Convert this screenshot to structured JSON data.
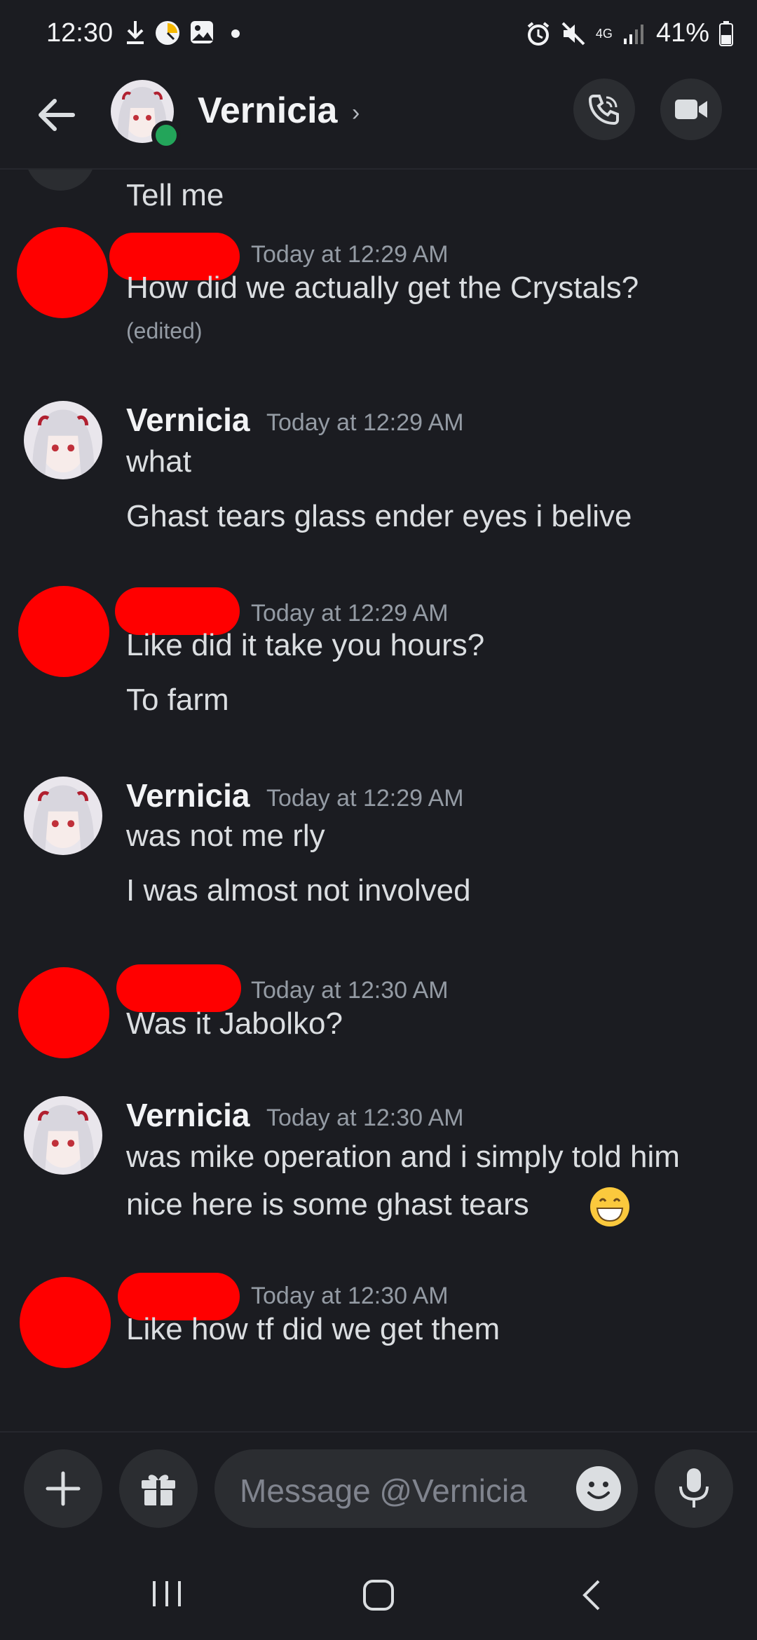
{
  "status_bar": {
    "time": "12:30",
    "battery": "41%",
    "network": "4G"
  },
  "header": {
    "contact_name": "Vernicia",
    "chevron": "›",
    "icons": [
      "back-arrow-icon",
      "voice-call-icon",
      "video-call-icon"
    ]
  },
  "partial_message": {
    "text": "Tell me"
  },
  "messages": [
    {
      "author": "",
      "redacted": true,
      "timestamp": "Today at 12:29 AM",
      "lines": [
        "How did we actually get the Crystals?"
      ],
      "edited": "(edited)"
    },
    {
      "author": "Vernicia",
      "redacted": false,
      "timestamp": "Today at 12:29 AM",
      "lines": [
        "what",
        "Ghast tears glass ender eyes i belive"
      ]
    },
    {
      "author": "",
      "redacted": true,
      "timestamp": "Today at 12:29 AM",
      "lines": [
        "Like did it take you hours?",
        "To farm"
      ]
    },
    {
      "author": "Vernicia",
      "redacted": false,
      "timestamp": "Today at 12:29 AM",
      "lines": [
        "was not me rly",
        "I was almost not involved"
      ]
    },
    {
      "author": "",
      "redacted": true,
      "timestamp": "Today at 12:30 AM",
      "lines": [
        "Was it Jabolko?"
      ]
    },
    {
      "author": "Vernicia",
      "redacted": false,
      "timestamp": "Today at 12:30 AM",
      "lines": [
        "was mike operation and i simply told him",
        "nice here is some ghast tears"
      ],
      "emoji": "grinning-face-emoji"
    },
    {
      "author": "",
      "redacted": true,
      "timestamp": "Today at 12:30 AM",
      "lines": [
        "Like how tf did we get them"
      ]
    }
  ],
  "composer": {
    "placeholder": "Message @Vernicia",
    "icons": [
      "plus-icon",
      "gift-icon",
      "emoji-icon",
      "microphone-icon"
    ]
  },
  "colors": {
    "background": "#1b1c21",
    "button_bg": "#2b2d31",
    "online": "#23a55a",
    "redaction": "#ff0000"
  }
}
